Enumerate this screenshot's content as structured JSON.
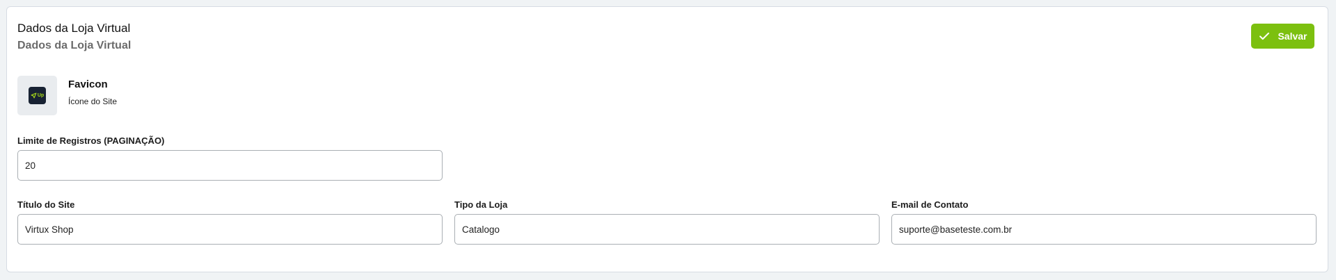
{
  "header": {
    "title": "Dados da Loja Virtual",
    "subtitle": "Dados da Loja Virtual"
  },
  "toolbar": {
    "save_label": "Salvar"
  },
  "favicon": {
    "title": "Favicon",
    "description": "Ícone do Site",
    "badge_text": "Up"
  },
  "fields": {
    "limit": {
      "label": "Limite de Registros (PAGINAÇÃO)",
      "value": "20"
    },
    "site_title": {
      "label": "Título do Site",
      "value": "Virtux Shop"
    },
    "store_type": {
      "label": "Tipo da Loja",
      "value": "Catalogo"
    },
    "contact_email": {
      "label": "E-mail de Contato",
      "value": "suporte@baseteste.com.br"
    }
  },
  "colors": {
    "accent": "#7cc00f",
    "background": "#f0f3f5",
    "favicon_bg": "#182233",
    "favicon_fg": "#a7d81a"
  }
}
